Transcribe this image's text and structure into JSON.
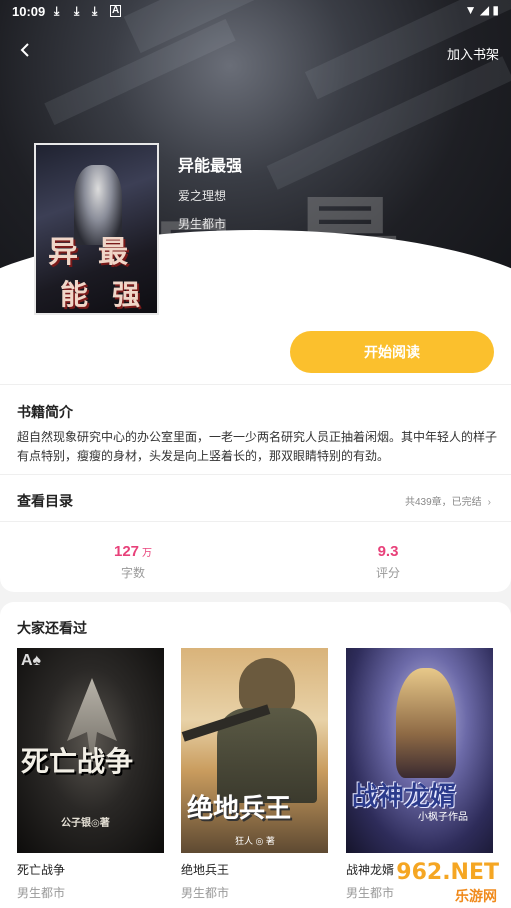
{
  "status_bar": {
    "time": "10:09",
    "indicators": [
      "download-icon",
      "download-icon",
      "download-icon",
      "notification-icon"
    ],
    "system": [
      "wifi-icon",
      "signal-icon",
      "battery-icon"
    ]
  },
  "header": {
    "add_to_shelf": "加入书架"
  },
  "book": {
    "title": "异能最强",
    "author": "爱之理想",
    "category": "男生都市",
    "cover_text": [
      "异",
      "最",
      "能",
      "强"
    ]
  },
  "actions": {
    "start_reading": "开始阅读"
  },
  "intro": {
    "title": "书籍简介",
    "text": "超自然现象研究中心的办公室里面，一老一少两名研究人员正抽着闲烟。其中年轻人的样子有点特别，瘦瘦的身材，头发是向上竖着长的，那双眼睛特别的有劲。"
  },
  "toc": {
    "title": "查看目录",
    "meta": "共439章，已完结"
  },
  "stats": {
    "words": {
      "value": "127",
      "unit": "万",
      "label": "字数"
    },
    "rating": {
      "value": "9.3",
      "label": "评分"
    }
  },
  "recommend": {
    "title": "大家还看过",
    "books": [
      {
        "name": "死亡战争",
        "category": "男生都市",
        "cover_title": "死亡战争",
        "cover_author": "公子银◎著"
      },
      {
        "name": "绝地兵王",
        "category": "男生都市",
        "cover_title": "绝地兵王",
        "cover_author": "狂人 ◎ 著"
      },
      {
        "name": "战神龙婿",
        "category": "男生都市",
        "cover_title": "战神龙婿",
        "cover_author": "小枫子作品"
      }
    ]
  },
  "watermark": {
    "big": "962.NET",
    "small": "乐游网"
  },
  "colors": {
    "accent_button": "#fbc02d",
    "stat_number": "#e8417a"
  }
}
